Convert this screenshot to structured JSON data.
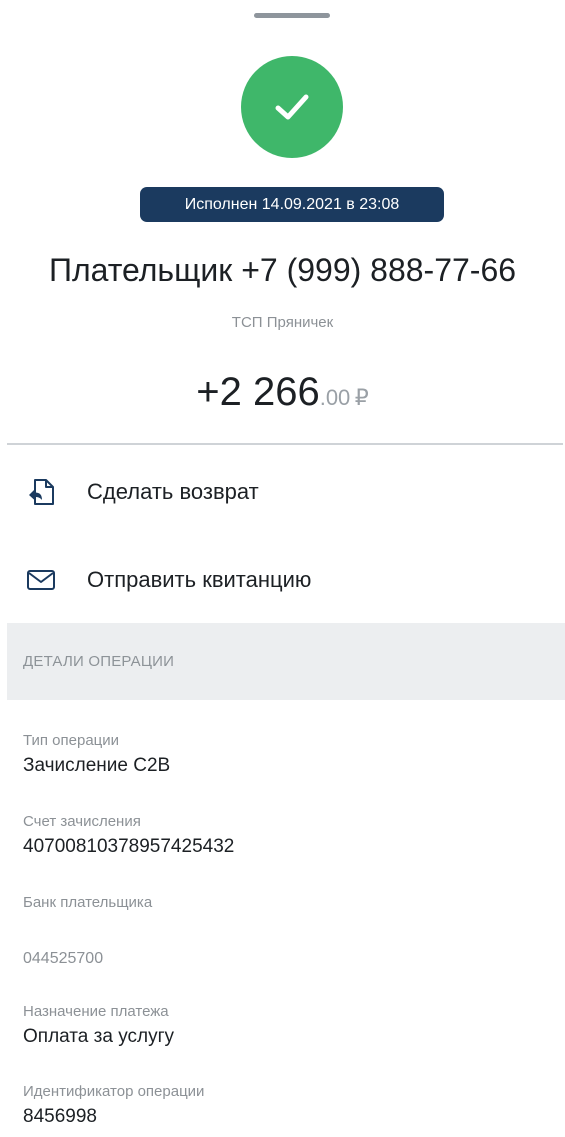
{
  "status": {
    "badge_text": "Исполнен 14.09.2021 в 23:08",
    "icon": "checkmark-icon",
    "color": "#3fb76a"
  },
  "header": {
    "title": "Плательщик +7 (999) 888-77-66",
    "merchant": "ТСП Пряничек"
  },
  "amount": {
    "integer": "+2 266",
    "fraction": ".00",
    "currency": "₽"
  },
  "actions": [
    {
      "label": "Сделать возврат",
      "icon": "refund-icon"
    },
    {
      "label": "Отправить квитанцию",
      "icon": "envelope-icon"
    }
  ],
  "details": {
    "section_title": "ДЕТАЛИ ОПЕРАЦИИ",
    "items": [
      {
        "label": "Тип операции",
        "value": "Зачисление C2B"
      },
      {
        "label": "Счет зачисления",
        "value": "40700810378957425432"
      },
      {
        "label": "Банк плательщика",
        "value": ""
      },
      {
        "label": "",
        "value": "044525700"
      },
      {
        "label": "Назначение платежа",
        "value": "Оплата за услугу"
      },
      {
        "label": "Идентификатор операции",
        "value": "8456998"
      }
    ]
  },
  "colors": {
    "accent_navy": "#1b3a5f",
    "success_green": "#3fb76a"
  }
}
